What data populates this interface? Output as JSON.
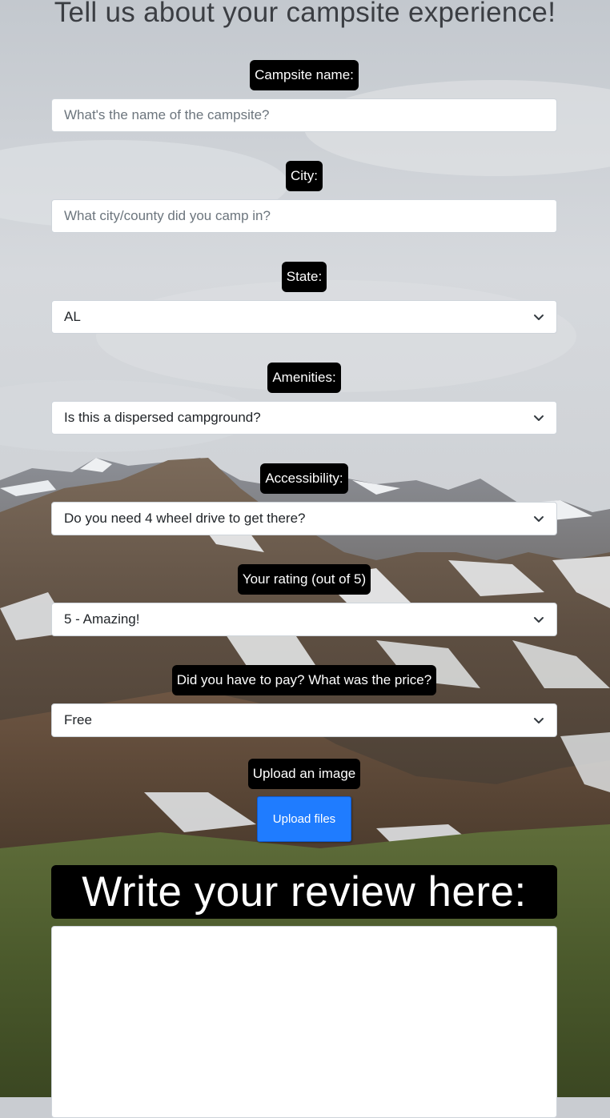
{
  "page": {
    "title": "Tell us about your campsite experience!"
  },
  "form": {
    "campsite_name": {
      "label": "Campsite name:",
      "placeholder": "What's the name of the campsite?",
      "value": ""
    },
    "city": {
      "label": "City:",
      "placeholder": "What city/county did you camp in?",
      "value": ""
    },
    "state": {
      "label": "State:",
      "selected": "AL"
    },
    "amenities": {
      "label": "Amenities:",
      "selected": "Is this a dispersed campground?"
    },
    "accessibility": {
      "label": "Accessibility:",
      "selected": "Do you need 4 wheel drive to get there?"
    },
    "rating": {
      "label": "Your rating (out of 5)",
      "selected": "5 - Amazing!"
    },
    "price": {
      "label": "Did you have to pay? What was the price?",
      "selected": "Free"
    },
    "upload": {
      "label": "Upload an image",
      "button_label": "Upload files"
    },
    "review": {
      "label": "Write your review here:",
      "value": ""
    }
  },
  "icons": {
    "select_caret": "chevron-down-icon"
  },
  "colors": {
    "label_background": "#000000",
    "label_text": "#ffffff",
    "upload_button": "#1f7cff",
    "title_text": "#3b3e43"
  }
}
